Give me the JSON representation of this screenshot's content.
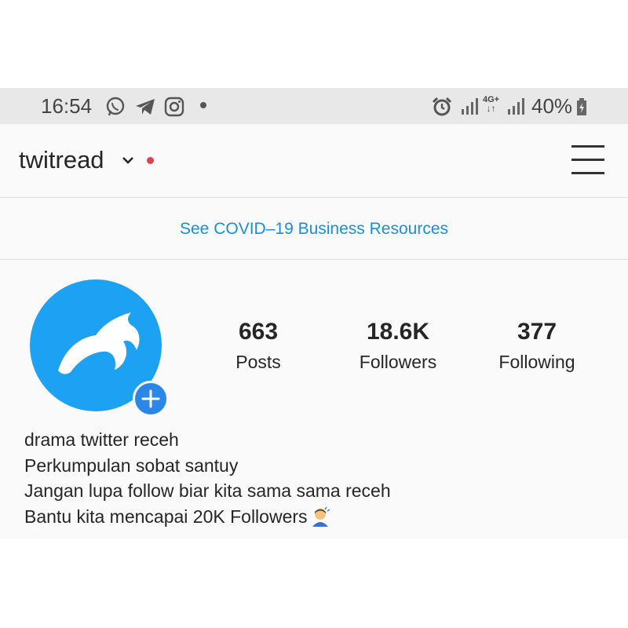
{
  "status_bar": {
    "time": "16:54",
    "network_label": "4G+",
    "battery": "40%",
    "icons": [
      "whatsapp-icon",
      "telegram-icon",
      "instagram-icon",
      "alarm-icon",
      "signal-icon",
      "battery-charging-icon"
    ]
  },
  "header": {
    "username": "twitread"
  },
  "banner": {
    "link_text": "See COVID–19 Business Resources"
  },
  "profile": {
    "stats": [
      {
        "value": "663",
        "label": "Posts"
      },
      {
        "value": "18.6K",
        "label": "Followers"
      },
      {
        "value": "377",
        "label": "Following"
      }
    ],
    "bio": [
      "drama twitter receh",
      "Perkumpulan sobat santuy",
      "Jangan lupa follow biar kita sama sama receh",
      "Bantu kita mencapai 20K Followers"
    ]
  },
  "colors": {
    "link": "#1a8fd8",
    "avatar_bg": "#1da1f2",
    "add_button": "#2a87e8",
    "notification_dot": "#e1414a"
  }
}
